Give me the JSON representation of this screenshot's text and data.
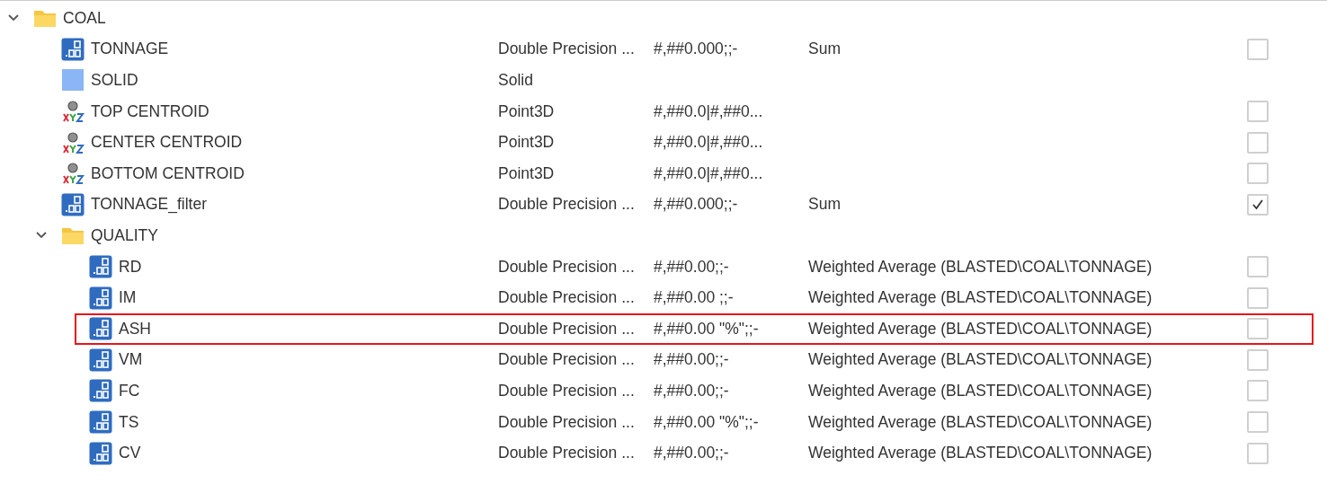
{
  "tree": [
    {
      "kind": "folder",
      "name": "COAL",
      "expanded": true,
      "children": [
        {
          "kind": "number",
          "name": "TONNAGE",
          "type": "Double Precision ...",
          "format": "#,##0.000;;-",
          "aggregate": "Sum",
          "checked": false,
          "highlighted": false
        },
        {
          "kind": "solid",
          "name": "SOLID",
          "type": "Solid",
          "highlighted": false
        },
        {
          "kind": "point",
          "name": "TOP CENTROID",
          "type": "Point3D",
          "format": "#,##0.0|#,##0...",
          "checked": false,
          "highlighted": false
        },
        {
          "kind": "point",
          "name": "CENTER CENTROID",
          "type": "Point3D",
          "format": "#,##0.0|#,##0...",
          "checked": false,
          "highlighted": false
        },
        {
          "kind": "point",
          "name": "BOTTOM CENTROID",
          "type": "Point3D",
          "format": "#,##0.0|#,##0...",
          "checked": false,
          "highlighted": false
        },
        {
          "kind": "number",
          "name": "TONNAGE_filter",
          "type": "Double Precision ...",
          "format": "#,##0.000;;-",
          "aggregate": "Sum",
          "checked": true,
          "highlighted": false
        },
        {
          "kind": "folder",
          "name": "QUALITY",
          "expanded": true,
          "children": [
            {
              "kind": "number",
              "name": "RD",
              "type": "Double Precision ...",
              "format": "#,##0.00;;-",
              "aggregate": "Weighted Average (BLASTED\\COAL\\TONNAGE)",
              "checked": false,
              "highlighted": false
            },
            {
              "kind": "number",
              "name": "IM",
              "type": "Double Precision ...",
              "format": "#,##0.00 ;;-",
              "aggregate": "Weighted Average (BLASTED\\COAL\\TONNAGE)",
              "checked": false,
              "highlighted": false
            },
            {
              "kind": "number",
              "name": "ASH",
              "type": "Double Precision ...",
              "format": "#,##0.00 \"%\";;-",
              "aggregate": "Weighted Average (BLASTED\\COAL\\TONNAGE)",
              "checked": false,
              "highlighted": true
            },
            {
              "kind": "number",
              "name": "VM",
              "type": "Double Precision ...",
              "format": "#,##0.00;;-",
              "aggregate": "Weighted Average (BLASTED\\COAL\\TONNAGE)",
              "checked": false,
              "highlighted": false
            },
            {
              "kind": "number",
              "name": "FC",
              "type": "Double Precision ...",
              "format": "#,##0.00;;-",
              "aggregate": "Weighted Average (BLASTED\\COAL\\TONNAGE)",
              "checked": false,
              "highlighted": false
            },
            {
              "kind": "number",
              "name": "TS",
              "type": "Double Precision ...",
              "format": "#,##0.00 \"%\";;-",
              "aggregate": "Weighted Average (BLASTED\\COAL\\TONNAGE)",
              "checked": false,
              "highlighted": false
            },
            {
              "kind": "number",
              "name": "CV",
              "type": "Double Precision ...",
              "format": "#,##0.00;;-",
              "aggregate": "Weighted Average (BLASTED\\COAL\\TONNAGE)",
              "checked": false,
              "highlighted": false
            }
          ]
        }
      ]
    }
  ]
}
